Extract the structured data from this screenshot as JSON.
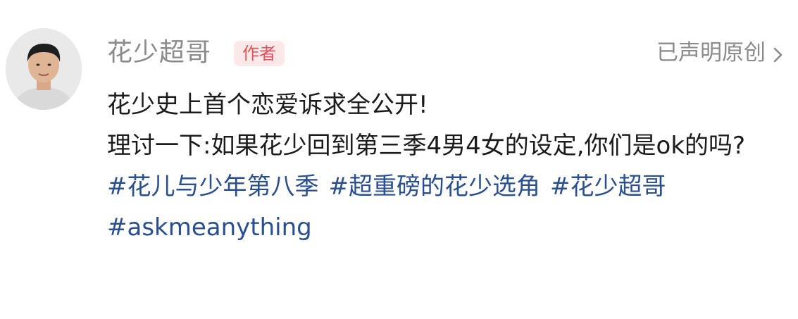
{
  "author": {
    "name": "花少超哥",
    "badge": "作者"
  },
  "header": {
    "original_label": "已声明原创",
    "chevron_icon": "chevron-right-icon"
  },
  "post": {
    "line1": "花少史上首个恋爱诉求全公开!",
    "line2": "理讨一下:如果花少回到第三季4男4女的设定,你们是ok的吗?",
    "hashtags": [
      "#花儿与少年第八季",
      "#超重磅的花少选角",
      "#花少超哥",
      "#askmeanything"
    ]
  },
  "colors": {
    "text": "#1b1b1b",
    "muted": "#8a8a8a",
    "badge_text": "#e2545c",
    "badge_bg": "#fbe9ea",
    "hashtag": "#2a4f8f"
  }
}
